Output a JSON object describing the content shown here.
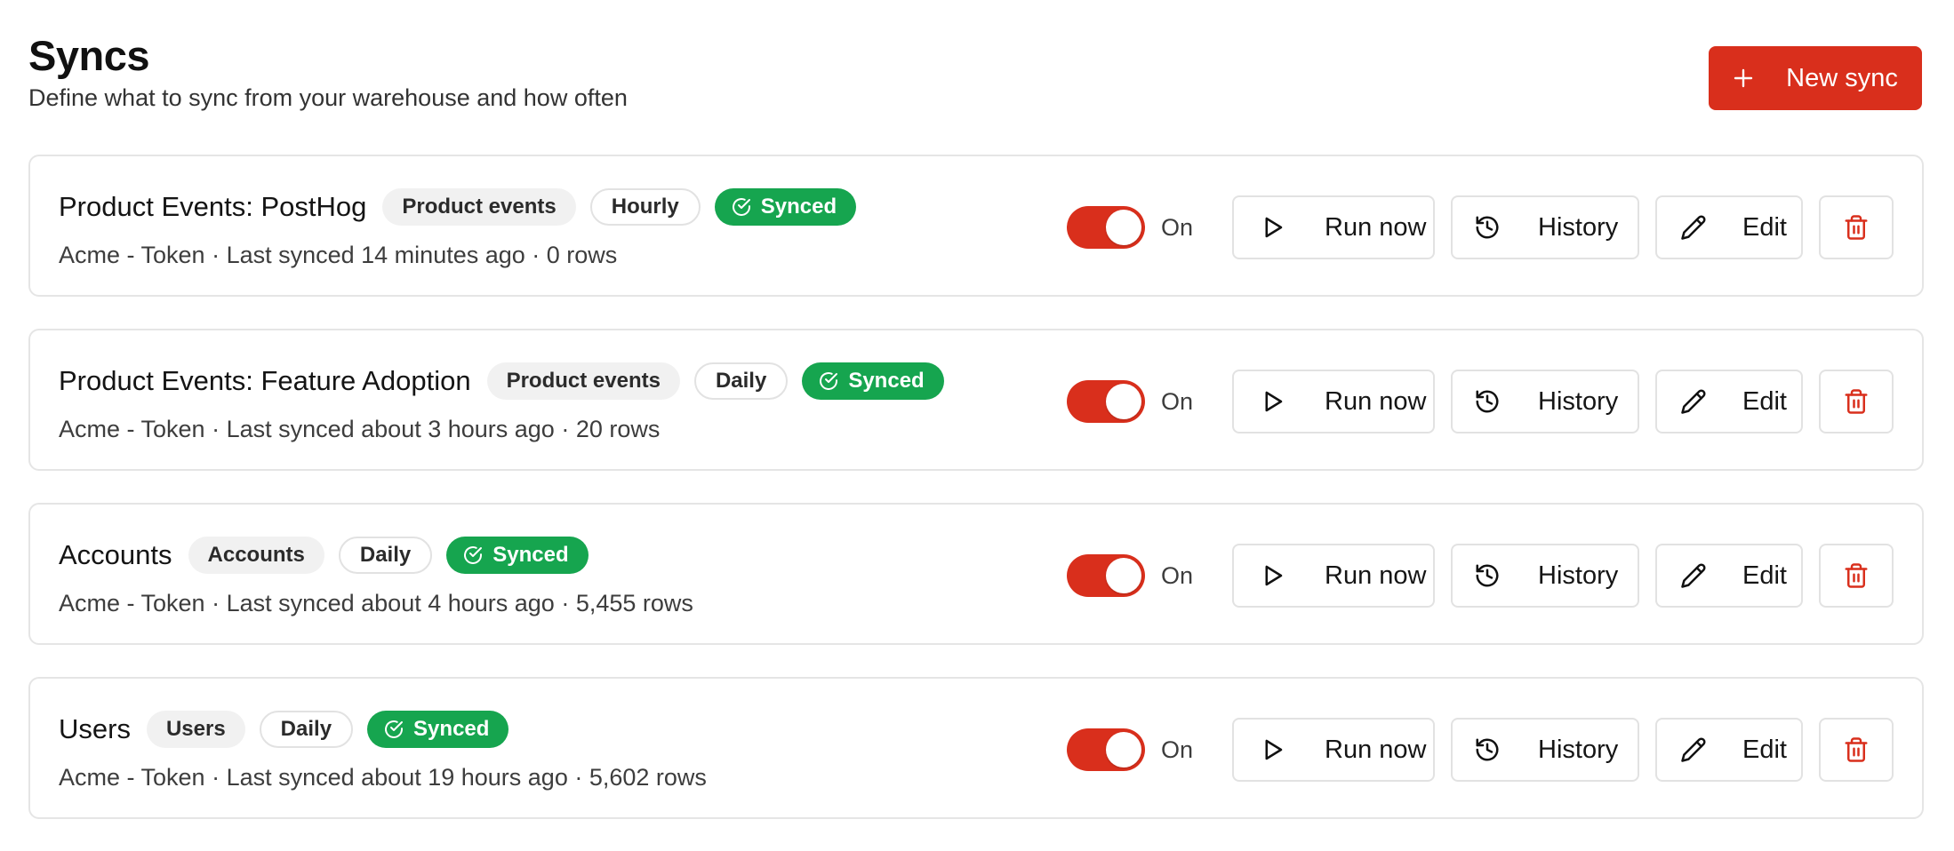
{
  "page": {
    "title": "Syncs",
    "subtitle": "Define what to sync from your warehouse and how often",
    "new_sync_label": "New sync"
  },
  "colors": {
    "accent": "#d92f1c",
    "synced_badge": "#16a54f",
    "border": "#e5e5e5"
  },
  "icons": {
    "new_sync": "plus-icon",
    "synced": "check-circle-icon",
    "run": "play-icon",
    "history": "history-icon",
    "edit": "pencil-icon",
    "delete": "trash-icon"
  },
  "syncs": [
    {
      "name": "Product Events: PostHog",
      "type": "Product events",
      "frequency": "Hourly",
      "status": "Synced",
      "meta": "Acme - Token · Last synced 14 minutes ago · 0 rows",
      "enabled": true,
      "toggle_label": "On",
      "run_label": "Run now",
      "history_label": "History",
      "edit_label": "Edit"
    },
    {
      "name": "Product Events: Feature Adoption",
      "type": "Product events",
      "frequency": "Daily",
      "status": "Synced",
      "meta": "Acme - Token · Last synced about 3 hours ago · 20 rows",
      "enabled": true,
      "toggle_label": "On",
      "run_label": "Run now",
      "history_label": "History",
      "edit_label": "Edit"
    },
    {
      "name": "Accounts",
      "type": "Accounts",
      "frequency": "Daily",
      "status": "Synced",
      "meta": "Acme - Token · Last synced about 4 hours ago · 5,455 rows",
      "enabled": true,
      "toggle_label": "On",
      "run_label": "Run now",
      "history_label": "History",
      "edit_label": "Edit"
    },
    {
      "name": "Users",
      "type": "Users",
      "frequency": "Daily",
      "status": "Synced",
      "meta": "Acme - Token · Last synced about 19 hours ago · 5,602 rows",
      "enabled": true,
      "toggle_label": "On",
      "run_label": "Run now",
      "history_label": "History",
      "edit_label": "Edit"
    }
  ]
}
